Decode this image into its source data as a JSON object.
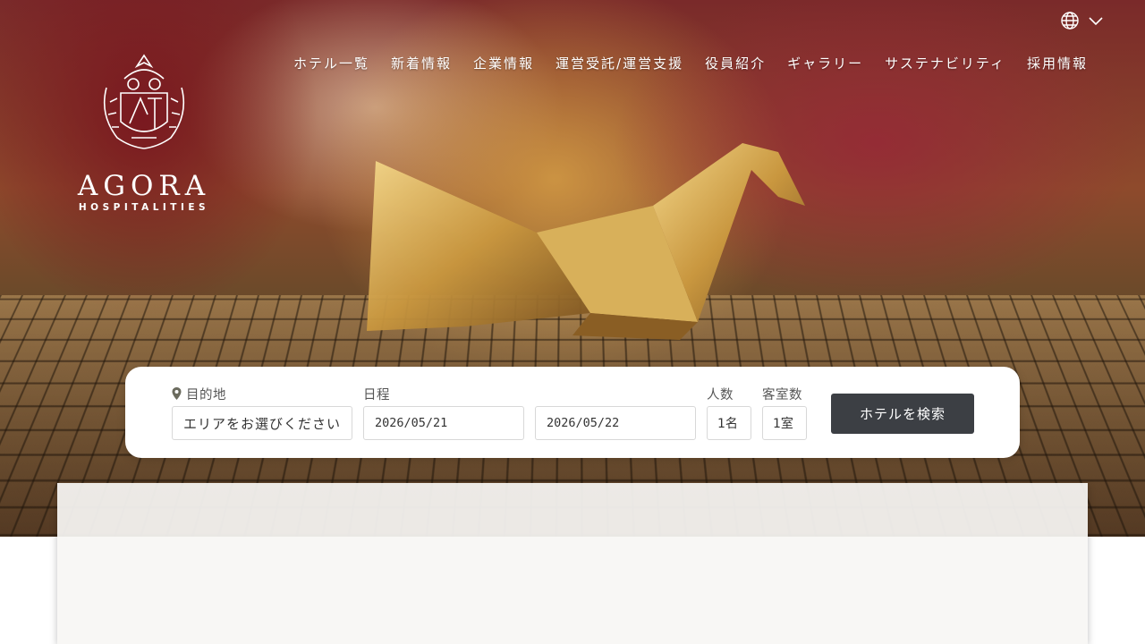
{
  "brand": {
    "name": "AGORA",
    "tagline": "HOSPITALITIES"
  },
  "header": {
    "language_icon": "globe-icon",
    "language_caret_icon": "chevron-down-icon"
  },
  "nav": {
    "items": [
      {
        "label": "ホテル一覧"
      },
      {
        "label": "新着情報"
      },
      {
        "label": "企業情報"
      },
      {
        "label": "運営受託/運営支援"
      },
      {
        "label": "役員紹介"
      },
      {
        "label": "ギャラリー"
      },
      {
        "label": "サステナビリティ"
      },
      {
        "label": "採用情報"
      }
    ]
  },
  "search": {
    "destination": {
      "label": "目的地",
      "icon": "map-pin-icon",
      "value": "エリアをお選びください"
    },
    "dates": {
      "label": "日程",
      "checkin": "2026/05/21",
      "checkout": "2026/05/22"
    },
    "guests": {
      "label": "人数",
      "value": "1名"
    },
    "rooms": {
      "label": "客室数",
      "value": "1室"
    },
    "submit_label": "ホテルを検索"
  },
  "colors": {
    "button": "#3c3f44",
    "panel": "#f8f6f4"
  }
}
